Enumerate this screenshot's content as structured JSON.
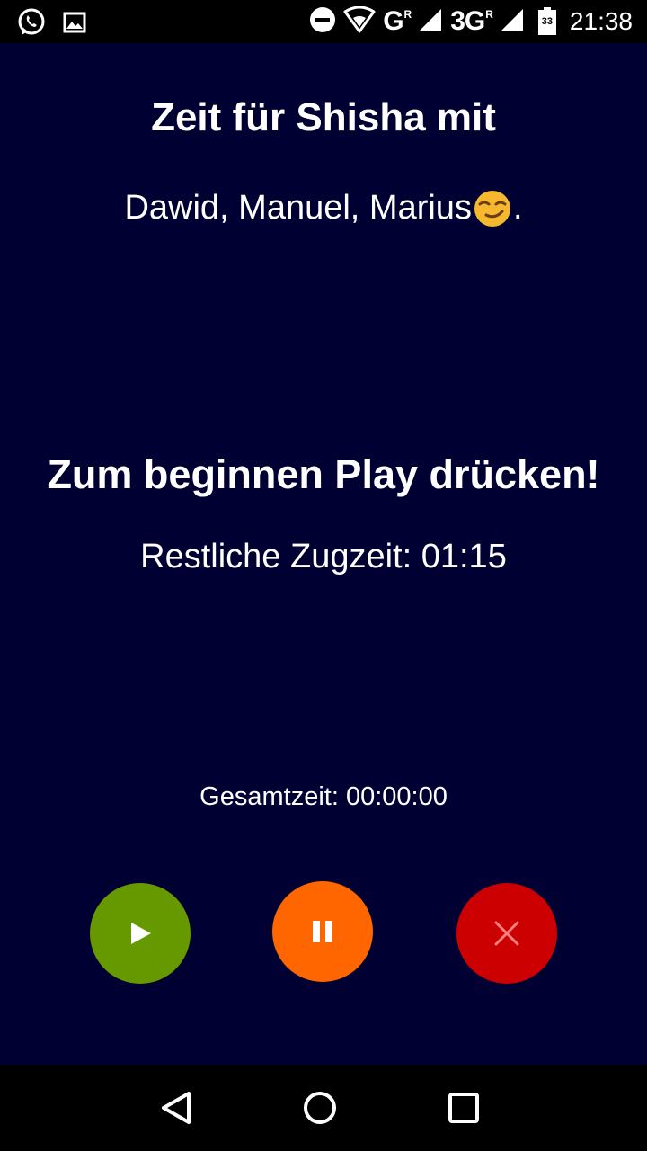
{
  "status_bar": {
    "net1": "G",
    "net1_sup": "R",
    "net2": "3G",
    "net2_sup": "R",
    "battery": "33",
    "time": "21:38",
    "icons": [
      "whatsapp-icon",
      "image-icon",
      "do-not-disturb-icon",
      "wifi-icon",
      "signal-icon",
      "battery-icon"
    ]
  },
  "app": {
    "title": "Zeit für Shisha mit",
    "participants": "Dawid, Manuel, Marius",
    "participants_suffix": ".",
    "emoji": "smirking-face-icon",
    "instruction": "Zum beginnen Play drücken!",
    "remaining_time": "Restliche Zugzeit: 01:15",
    "total_time": "Gesamtzeit: 00:00:00",
    "background_color": "#000033"
  },
  "controls": {
    "play": {
      "icon": "play-icon",
      "color": "#669900"
    },
    "pause": {
      "icon": "pause-icon",
      "color": "#ff6600"
    },
    "stop": {
      "icon": "close-icon",
      "color": "#cc0000"
    }
  },
  "nav_bar": {
    "icons": [
      "back-icon",
      "home-icon",
      "recents-icon"
    ]
  }
}
